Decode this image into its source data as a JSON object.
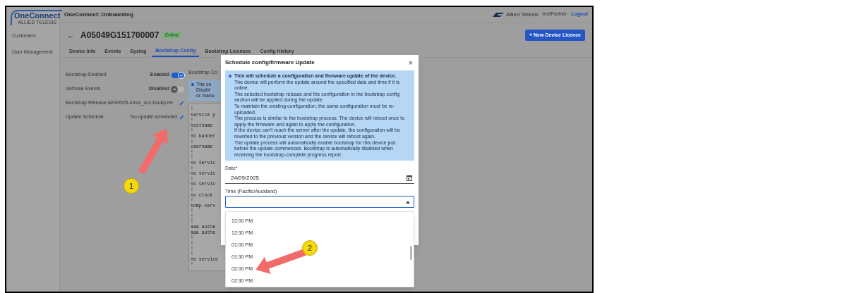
{
  "app": {
    "logo_text": "OneConnect",
    "logo_subtext": "ALLIED TELESIS",
    "title": "OneConnect: Onboarding",
    "brand": "Allied Telesis",
    "user": "testPartner",
    "logout": "Logout"
  },
  "sidebar": {
    "items": [
      {
        "label": "Customers",
        "selected": false
      },
      {
        "label": "User Management",
        "selected": false
      }
    ]
  },
  "device": {
    "back": "←",
    "id": "A05049G151700007",
    "status": "Online",
    "new_button": "+ New Device Licence"
  },
  "tabs": [
    {
      "label": "Device Info",
      "selected": false
    },
    {
      "label": "Events",
      "selected": false
    },
    {
      "label": "Syslog",
      "selected": false
    },
    {
      "label": "Bootstrap Config",
      "selected": true
    },
    {
      "label": "Bootstrap Licenses",
      "selected": false
    },
    {
      "label": "Config History",
      "selected": false
    }
  ],
  "settings": [
    {
      "kind": "toggle",
      "label": "Bootstrap Enabled",
      "value": "Enabled",
      "on": true
    },
    {
      "kind": "toggle",
      "label": "Verbose Events",
      "value": "Disabled",
      "on": false
    },
    {
      "kind": "edit",
      "label": "Bootstrap Release:AR40505-torus_ccc-bsukp.rel"
    },
    {
      "kind": "edit",
      "label": "Update Schedule:",
      "value": "No update scheduled"
    }
  ],
  "config_panel": {
    "title": "Bootstrap Co",
    "notice_lines": [
      "The co",
      "Disabl",
      "or manu"
    ],
    "code_lines": [
      "!",
      "service p",
      "!",
      "hostname",
      "!",
      "no banner",
      "!",
      "username",
      "!",
      "!",
      "no servic",
      "!",
      "no servic",
      "!",
      "no servic",
      "!",
      "no clock",
      "!",
      "snmp-serv",
      "!",
      "!",
      "!",
      "aaa authe",
      "aaa authe",
      "!",
      "!",
      "!",
      "!",
      "no service",
      "!"
    ]
  },
  "dialog": {
    "title": "Schedule config/firmware Update",
    "close": "×",
    "info_heading": "This will schedule a configuration and firmware update of the device.",
    "info_paragraphs": [
      "The device will perform the update around the specified date and time if it is online.",
      "The selected bootstrap release and the configuration in the bootstrap config section will be applied during the update.",
      "To maintain the existing configuration, the same configuration must be re-uploaded.",
      "The process is similar to the bootstrap process. The device will reboot once to apply the firmware and again to apply the configuration.",
      "If the device can't reach the server after the update, the configuration will be reverted to the previous version and the device will reboot again.",
      "The update process will automatically enable bootstrap for this device just before the update commences. Bootstrap is automatically disabled when receiving the bootstrap-complete progress report."
    ],
    "date": {
      "label": "Date*",
      "value": "24/09/2025"
    },
    "time": {
      "label": "Time (Pacific/Auckland)",
      "expanded": true
    },
    "options": [
      {
        "label": "12:00 PM",
        "selected": false
      },
      {
        "label": "12:30 PM",
        "selected": false
      },
      {
        "label": "01:00 PM",
        "selected": false
      },
      {
        "label": "01:30 PM",
        "selected": false
      },
      {
        "label": "02:00 PM",
        "selected": false
      },
      {
        "label": "02:30 PM",
        "selected": false
      }
    ]
  },
  "callouts": [
    {
      "number": "1"
    },
    {
      "number": "2"
    }
  ]
}
